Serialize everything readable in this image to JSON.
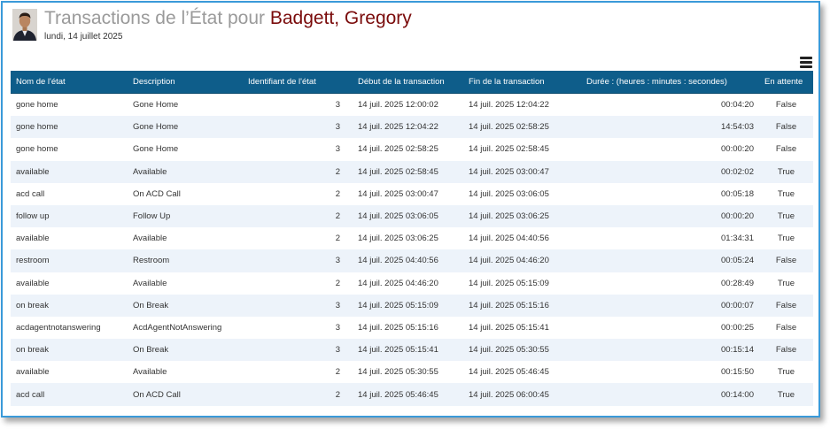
{
  "header": {
    "title_prefix": "Transactions de l’État pour",
    "agent_name": "Badgett, Gregory",
    "date": "lundi, 14 juillet 2025"
  },
  "toolbar": {
    "menu_icon": "hamburger-menu-icon"
  },
  "table": {
    "columns": [
      "Nom de l'état",
      "Description",
      "Identifiant de l'état",
      "Début de la transaction",
      "Fin de la transaction",
      "Durée : (heures : minutes : secondes)",
      "En attente"
    ],
    "rows": [
      {
        "state": "gone home",
        "description": "Gone Home",
        "id": "3",
        "start": "14 juil. 2025 12:00:02",
        "end": "14 juil. 2025 12:04:22",
        "duration": "00:04:20",
        "pending": "False"
      },
      {
        "state": "gone home",
        "description": "Gone Home",
        "id": "3",
        "start": "14 juil. 2025 12:04:22",
        "end": "14 juil. 2025 02:58:25",
        "duration": "14:54:03",
        "pending": "False"
      },
      {
        "state": "gone home",
        "description": "Gone Home",
        "id": "3",
        "start": "14 juil. 2025 02:58:25",
        "end": "14 juil. 2025 02:58:45",
        "duration": "00:00:20",
        "pending": "False"
      },
      {
        "state": "available",
        "description": "Available",
        "id": "2",
        "start": "14 juil. 2025 02:58:45",
        "end": "14 juil. 2025 03:00:47",
        "duration": "00:02:02",
        "pending": "True"
      },
      {
        "state": "acd call",
        "description": "On ACD Call",
        "id": "2",
        "start": "14 juil. 2025 03:00:47",
        "end": "14 juil. 2025 03:06:05",
        "duration": "00:05:18",
        "pending": "True"
      },
      {
        "state": "follow up",
        "description": "Follow Up",
        "id": "2",
        "start": "14 juil. 2025 03:06:05",
        "end": "14 juil. 2025 03:06:25",
        "duration": "00:00:20",
        "pending": "True"
      },
      {
        "state": "available",
        "description": "Available",
        "id": "2",
        "start": "14 juil. 2025 03:06:25",
        "end": "14 juil. 2025 04:40:56",
        "duration": "01:34:31",
        "pending": "True"
      },
      {
        "state": "restroom",
        "description": "Restroom",
        "id": "3",
        "start": "14 juil. 2025 04:40:56",
        "end": "14 juil. 2025 04:46:20",
        "duration": "00:05:24",
        "pending": "False"
      },
      {
        "state": "available",
        "description": "Available",
        "id": "2",
        "start": "14 juil. 2025 04:46:20",
        "end": "14 juil. 2025 05:15:09",
        "duration": "00:28:49",
        "pending": "True"
      },
      {
        "state": "on break",
        "description": "On Break",
        "id": "3",
        "start": "14 juil. 2025 05:15:09",
        "end": "14 juil. 2025 05:15:16",
        "duration": "00:00:07",
        "pending": "False"
      },
      {
        "state": "acdagentnotanswering",
        "description": "AcdAgentNotAnswering",
        "id": "3",
        "start": "14 juil. 2025 05:15:16",
        "end": "14 juil. 2025 05:15:41",
        "duration": "00:00:25",
        "pending": "False"
      },
      {
        "state": "on break",
        "description": "On Break",
        "id": "3",
        "start": "14 juil. 2025 05:15:41",
        "end": "14 juil. 2025 05:30:55",
        "duration": "00:15:14",
        "pending": "False"
      },
      {
        "state": "available",
        "description": "Available",
        "id": "2",
        "start": "14 juil. 2025 05:30:55",
        "end": "14 juil. 2025 05:46:45",
        "duration": "00:15:50",
        "pending": "True"
      },
      {
        "state": "acd call",
        "description": "On ACD Call",
        "id": "2",
        "start": "14 juil. 2025 05:46:45",
        "end": "14 juil. 2025 06:00:45",
        "duration": "00:14:00",
        "pending": "True"
      }
    ]
  }
}
